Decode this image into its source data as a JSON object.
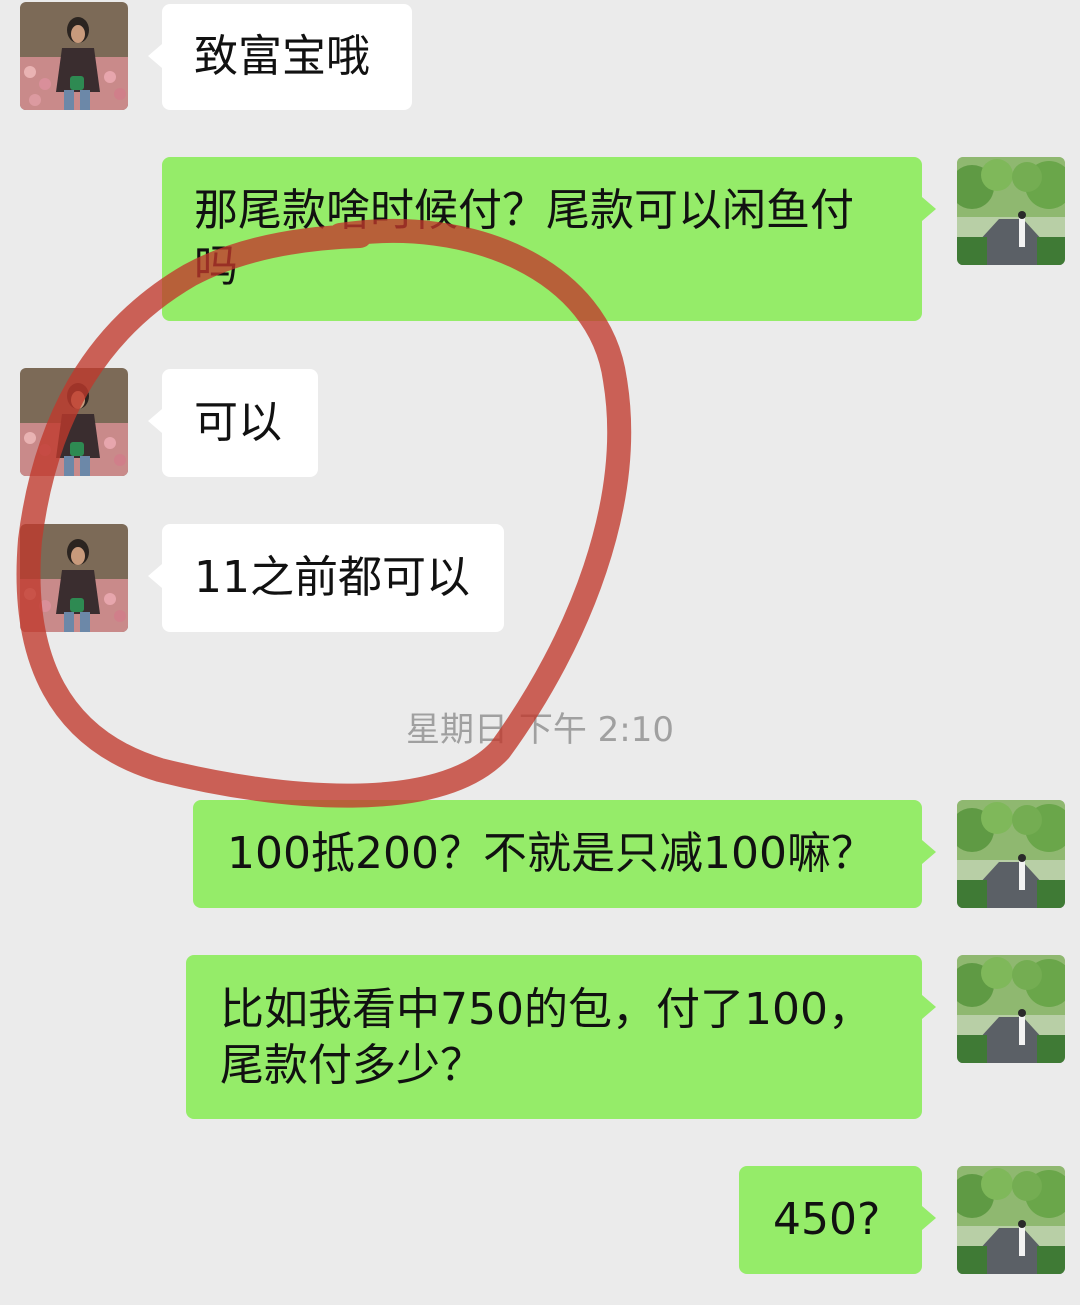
{
  "messages": [
    {
      "side": "in",
      "text": "致富宝哦"
    },
    {
      "side": "out",
      "text": "那尾款啥时候付？尾款可以闲鱼付\n吗"
    },
    {
      "side": "in",
      "text": "可以"
    },
    {
      "side": "in",
      "text": "11之前都可以"
    },
    {
      "side": "out",
      "text": "100抵200？不就是只减100嘛？"
    },
    {
      "side": "out",
      "text": "比如我看中750的包，付了100，\n尾款付多少？"
    },
    {
      "side": "out",
      "text": "450?"
    }
  ],
  "timestamp": "星期日 下午 2:10",
  "colors": {
    "background": "#ebebeb",
    "incoming_bubble": "#ffffff",
    "outgoing_bubble": "#95ec69",
    "annotation_circle": "#c0392b"
  }
}
